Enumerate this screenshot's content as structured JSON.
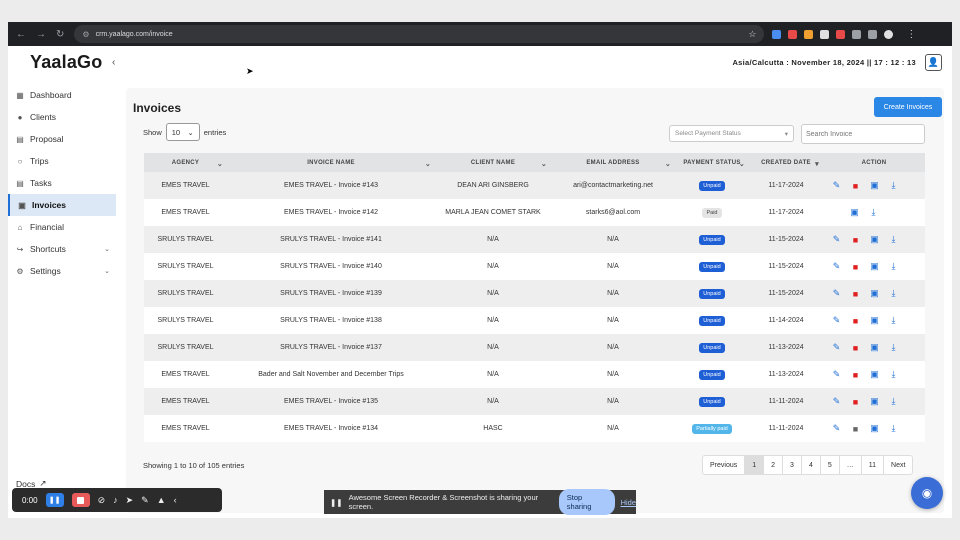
{
  "browser": {
    "url": "crm.yaalago.com/invoice"
  },
  "app": {
    "brand": "YaalaGo",
    "clock": "Asia/Calcutta : November 18, 2024 || 17 : 12 : 13"
  },
  "sidebar": {
    "items": [
      {
        "label": "Dashboard",
        "icon": "dashboard-icon"
      },
      {
        "label": "Clients",
        "icon": "user-icon"
      },
      {
        "label": "Proposal",
        "icon": "document-icon"
      },
      {
        "label": "Trips",
        "icon": "circle-icon"
      },
      {
        "label": "Tasks",
        "icon": "tasks-icon"
      },
      {
        "label": "Invoices",
        "icon": "invoice-icon"
      },
      {
        "label": "Financial",
        "icon": "bank-icon"
      },
      {
        "label": "Shortcuts",
        "icon": "share-icon"
      },
      {
        "label": "Settings",
        "icon": "gear-icon"
      }
    ],
    "docs": "Docs"
  },
  "page": {
    "title": "Invoices",
    "create_button": "Create Invoices",
    "show_label": "Show",
    "entries_label": "entries",
    "page_size": "10",
    "status_placeholder": "Select Payment Status",
    "search_placeholder": "Search Invoice"
  },
  "table": {
    "headers": [
      "AGENCY",
      "INVOICE NAME",
      "CLIENT NAME",
      "EMAIL ADDRESS",
      "PAYMENT STATUS",
      "CREATED DATE",
      "ACTION"
    ],
    "rows": [
      {
        "agency": "EMES TRAVEL",
        "invoice": "EMES TRAVEL - Invoice #143",
        "client": "DEAN ARI GINSBERG",
        "email": "ari@contactmarketing.net",
        "status": "Unpaid",
        "date": "11-17-2024"
      },
      {
        "agency": "EMES TRAVEL",
        "invoice": "EMES TRAVEL - Invoice #142",
        "client": "MARLA JEAN COMET STARK",
        "email": "starks6@aol.com",
        "status": "Paid",
        "date": "11-17-2024"
      },
      {
        "agency": "SRULYS TRAVEL",
        "invoice": "SRULYS TRAVEL - Invoice #141",
        "client": "N/A",
        "email": "N/A",
        "status": "Unpaid",
        "date": "11-15-2024"
      },
      {
        "agency": "SRULYS TRAVEL",
        "invoice": "SRULYS TRAVEL - Invoice #140",
        "client": "N/A",
        "email": "N/A",
        "status": "Unpaid",
        "date": "11-15-2024"
      },
      {
        "agency": "SRULYS TRAVEL",
        "invoice": "SRULYS TRAVEL - Invoice #139",
        "client": "N/A",
        "email": "N/A",
        "status": "Unpaid",
        "date": "11-15-2024"
      },
      {
        "agency": "SRULYS TRAVEL",
        "invoice": "SRULYS TRAVEL - Invoice #138",
        "client": "N/A",
        "email": "N/A",
        "status": "Unpaid",
        "date": "11-14-2024"
      },
      {
        "agency": "SRULYS TRAVEL",
        "invoice": "SRULYS TRAVEL - Invoice #137",
        "client": "N/A",
        "email": "N/A",
        "status": "Unpaid",
        "date": "11-13-2024"
      },
      {
        "agency": "EMES TRAVEL",
        "invoice": "Bader and Salt November and December Trips",
        "client": "N/A",
        "email": "N/A",
        "status": "Unpaid",
        "date": "11-13-2024"
      },
      {
        "agency": "EMES TRAVEL",
        "invoice": "EMES TRAVEL - Invoice #135",
        "client": "N/A",
        "email": "N/A",
        "status": "Unpaid",
        "date": "11-11-2024"
      },
      {
        "agency": "EMES TRAVEL",
        "invoice": "EMES TRAVEL - Invoice #134",
        "client": "HASC",
        "email": "N/A",
        "status": "Partially paid",
        "date": "11-11-2024"
      }
    ]
  },
  "footer": {
    "info": "Showing 1 to 10 of 105 entries",
    "pages": [
      "Previous",
      "1",
      "2",
      "3",
      "4",
      "5",
      "…",
      "11",
      "Next"
    ],
    "current_page": "1"
  },
  "recorder": {
    "time": "0:00",
    "share_text": "Awesome Screen Recorder & Screenshot is sharing your screen.",
    "stop_label": "Stop sharing",
    "hide_label": "Hide"
  },
  "colors": {
    "accent": "#2b87e6",
    "unpaid": "#1f5fd6",
    "partial": "#52b6ea",
    "delete": "#e02020",
    "active_nav_bg": "#dce8f5"
  }
}
